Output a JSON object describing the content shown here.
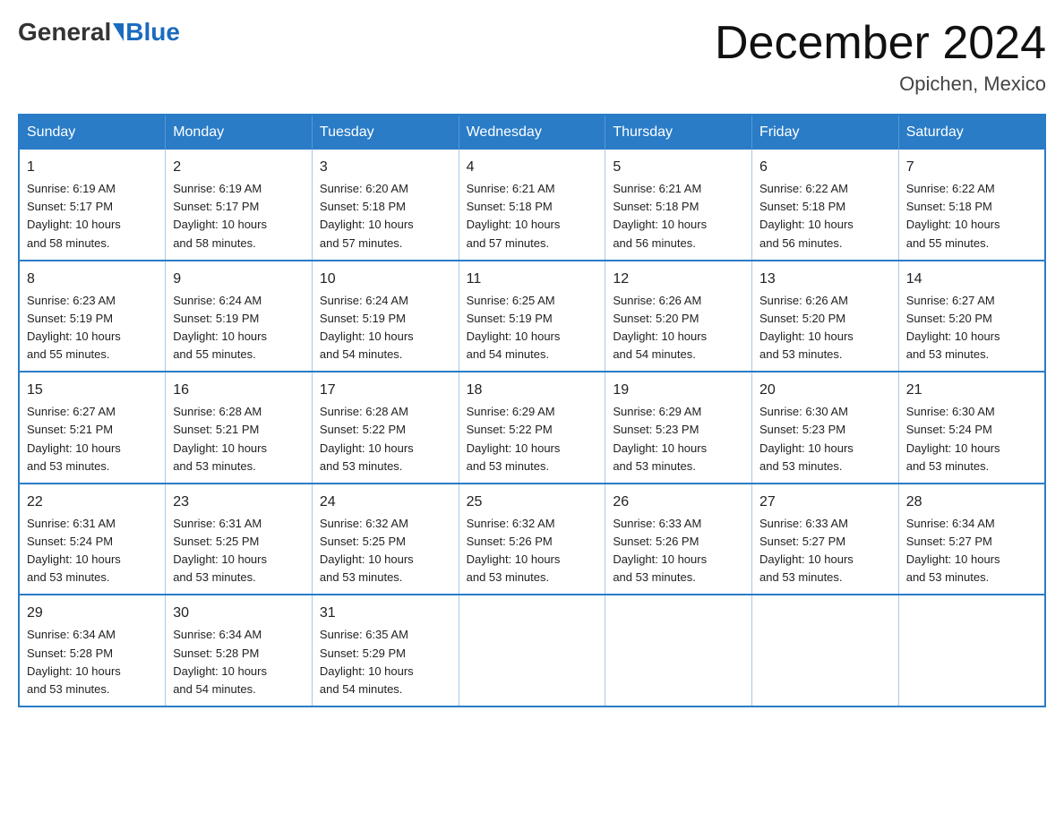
{
  "header": {
    "logo_general": "General",
    "logo_blue": "Blue",
    "month_title": "December 2024",
    "location": "Opichen, Mexico"
  },
  "weekdays": [
    "Sunday",
    "Monday",
    "Tuesday",
    "Wednesday",
    "Thursday",
    "Friday",
    "Saturday"
  ],
  "weeks": [
    [
      {
        "day": "1",
        "sunrise": "6:19 AM",
        "sunset": "5:17 PM",
        "daylight": "10 hours and 58 minutes."
      },
      {
        "day": "2",
        "sunrise": "6:19 AM",
        "sunset": "5:17 PM",
        "daylight": "10 hours and 58 minutes."
      },
      {
        "day": "3",
        "sunrise": "6:20 AM",
        "sunset": "5:18 PM",
        "daylight": "10 hours and 57 minutes."
      },
      {
        "day": "4",
        "sunrise": "6:21 AM",
        "sunset": "5:18 PM",
        "daylight": "10 hours and 57 minutes."
      },
      {
        "day": "5",
        "sunrise": "6:21 AM",
        "sunset": "5:18 PM",
        "daylight": "10 hours and 56 minutes."
      },
      {
        "day": "6",
        "sunrise": "6:22 AM",
        "sunset": "5:18 PM",
        "daylight": "10 hours and 56 minutes."
      },
      {
        "day": "7",
        "sunrise": "6:22 AM",
        "sunset": "5:18 PM",
        "daylight": "10 hours and 55 minutes."
      }
    ],
    [
      {
        "day": "8",
        "sunrise": "6:23 AM",
        "sunset": "5:19 PM",
        "daylight": "10 hours and 55 minutes."
      },
      {
        "day": "9",
        "sunrise": "6:24 AM",
        "sunset": "5:19 PM",
        "daylight": "10 hours and 55 minutes."
      },
      {
        "day": "10",
        "sunrise": "6:24 AM",
        "sunset": "5:19 PM",
        "daylight": "10 hours and 54 minutes."
      },
      {
        "day": "11",
        "sunrise": "6:25 AM",
        "sunset": "5:19 PM",
        "daylight": "10 hours and 54 minutes."
      },
      {
        "day": "12",
        "sunrise": "6:26 AM",
        "sunset": "5:20 PM",
        "daylight": "10 hours and 54 minutes."
      },
      {
        "day": "13",
        "sunrise": "6:26 AM",
        "sunset": "5:20 PM",
        "daylight": "10 hours and 53 minutes."
      },
      {
        "day": "14",
        "sunrise": "6:27 AM",
        "sunset": "5:20 PM",
        "daylight": "10 hours and 53 minutes."
      }
    ],
    [
      {
        "day": "15",
        "sunrise": "6:27 AM",
        "sunset": "5:21 PM",
        "daylight": "10 hours and 53 minutes."
      },
      {
        "day": "16",
        "sunrise": "6:28 AM",
        "sunset": "5:21 PM",
        "daylight": "10 hours and 53 minutes."
      },
      {
        "day": "17",
        "sunrise": "6:28 AM",
        "sunset": "5:22 PM",
        "daylight": "10 hours and 53 minutes."
      },
      {
        "day": "18",
        "sunrise": "6:29 AM",
        "sunset": "5:22 PM",
        "daylight": "10 hours and 53 minutes."
      },
      {
        "day": "19",
        "sunrise": "6:29 AM",
        "sunset": "5:23 PM",
        "daylight": "10 hours and 53 minutes."
      },
      {
        "day": "20",
        "sunrise": "6:30 AM",
        "sunset": "5:23 PM",
        "daylight": "10 hours and 53 minutes."
      },
      {
        "day": "21",
        "sunrise": "6:30 AM",
        "sunset": "5:24 PM",
        "daylight": "10 hours and 53 minutes."
      }
    ],
    [
      {
        "day": "22",
        "sunrise": "6:31 AM",
        "sunset": "5:24 PM",
        "daylight": "10 hours and 53 minutes."
      },
      {
        "day": "23",
        "sunrise": "6:31 AM",
        "sunset": "5:25 PM",
        "daylight": "10 hours and 53 minutes."
      },
      {
        "day": "24",
        "sunrise": "6:32 AM",
        "sunset": "5:25 PM",
        "daylight": "10 hours and 53 minutes."
      },
      {
        "day": "25",
        "sunrise": "6:32 AM",
        "sunset": "5:26 PM",
        "daylight": "10 hours and 53 minutes."
      },
      {
        "day": "26",
        "sunrise": "6:33 AM",
        "sunset": "5:26 PM",
        "daylight": "10 hours and 53 minutes."
      },
      {
        "day": "27",
        "sunrise": "6:33 AM",
        "sunset": "5:27 PM",
        "daylight": "10 hours and 53 minutes."
      },
      {
        "day": "28",
        "sunrise": "6:34 AM",
        "sunset": "5:27 PM",
        "daylight": "10 hours and 53 minutes."
      }
    ],
    [
      {
        "day": "29",
        "sunrise": "6:34 AM",
        "sunset": "5:28 PM",
        "daylight": "10 hours and 53 minutes."
      },
      {
        "day": "30",
        "sunrise": "6:34 AM",
        "sunset": "5:28 PM",
        "daylight": "10 hours and 54 minutes."
      },
      {
        "day": "31",
        "sunrise": "6:35 AM",
        "sunset": "5:29 PM",
        "daylight": "10 hours and 54 minutes."
      },
      null,
      null,
      null,
      null
    ]
  ],
  "labels": {
    "sunrise_prefix": "Sunrise: ",
    "sunset_prefix": "Sunset: ",
    "daylight_prefix": "Daylight: "
  }
}
